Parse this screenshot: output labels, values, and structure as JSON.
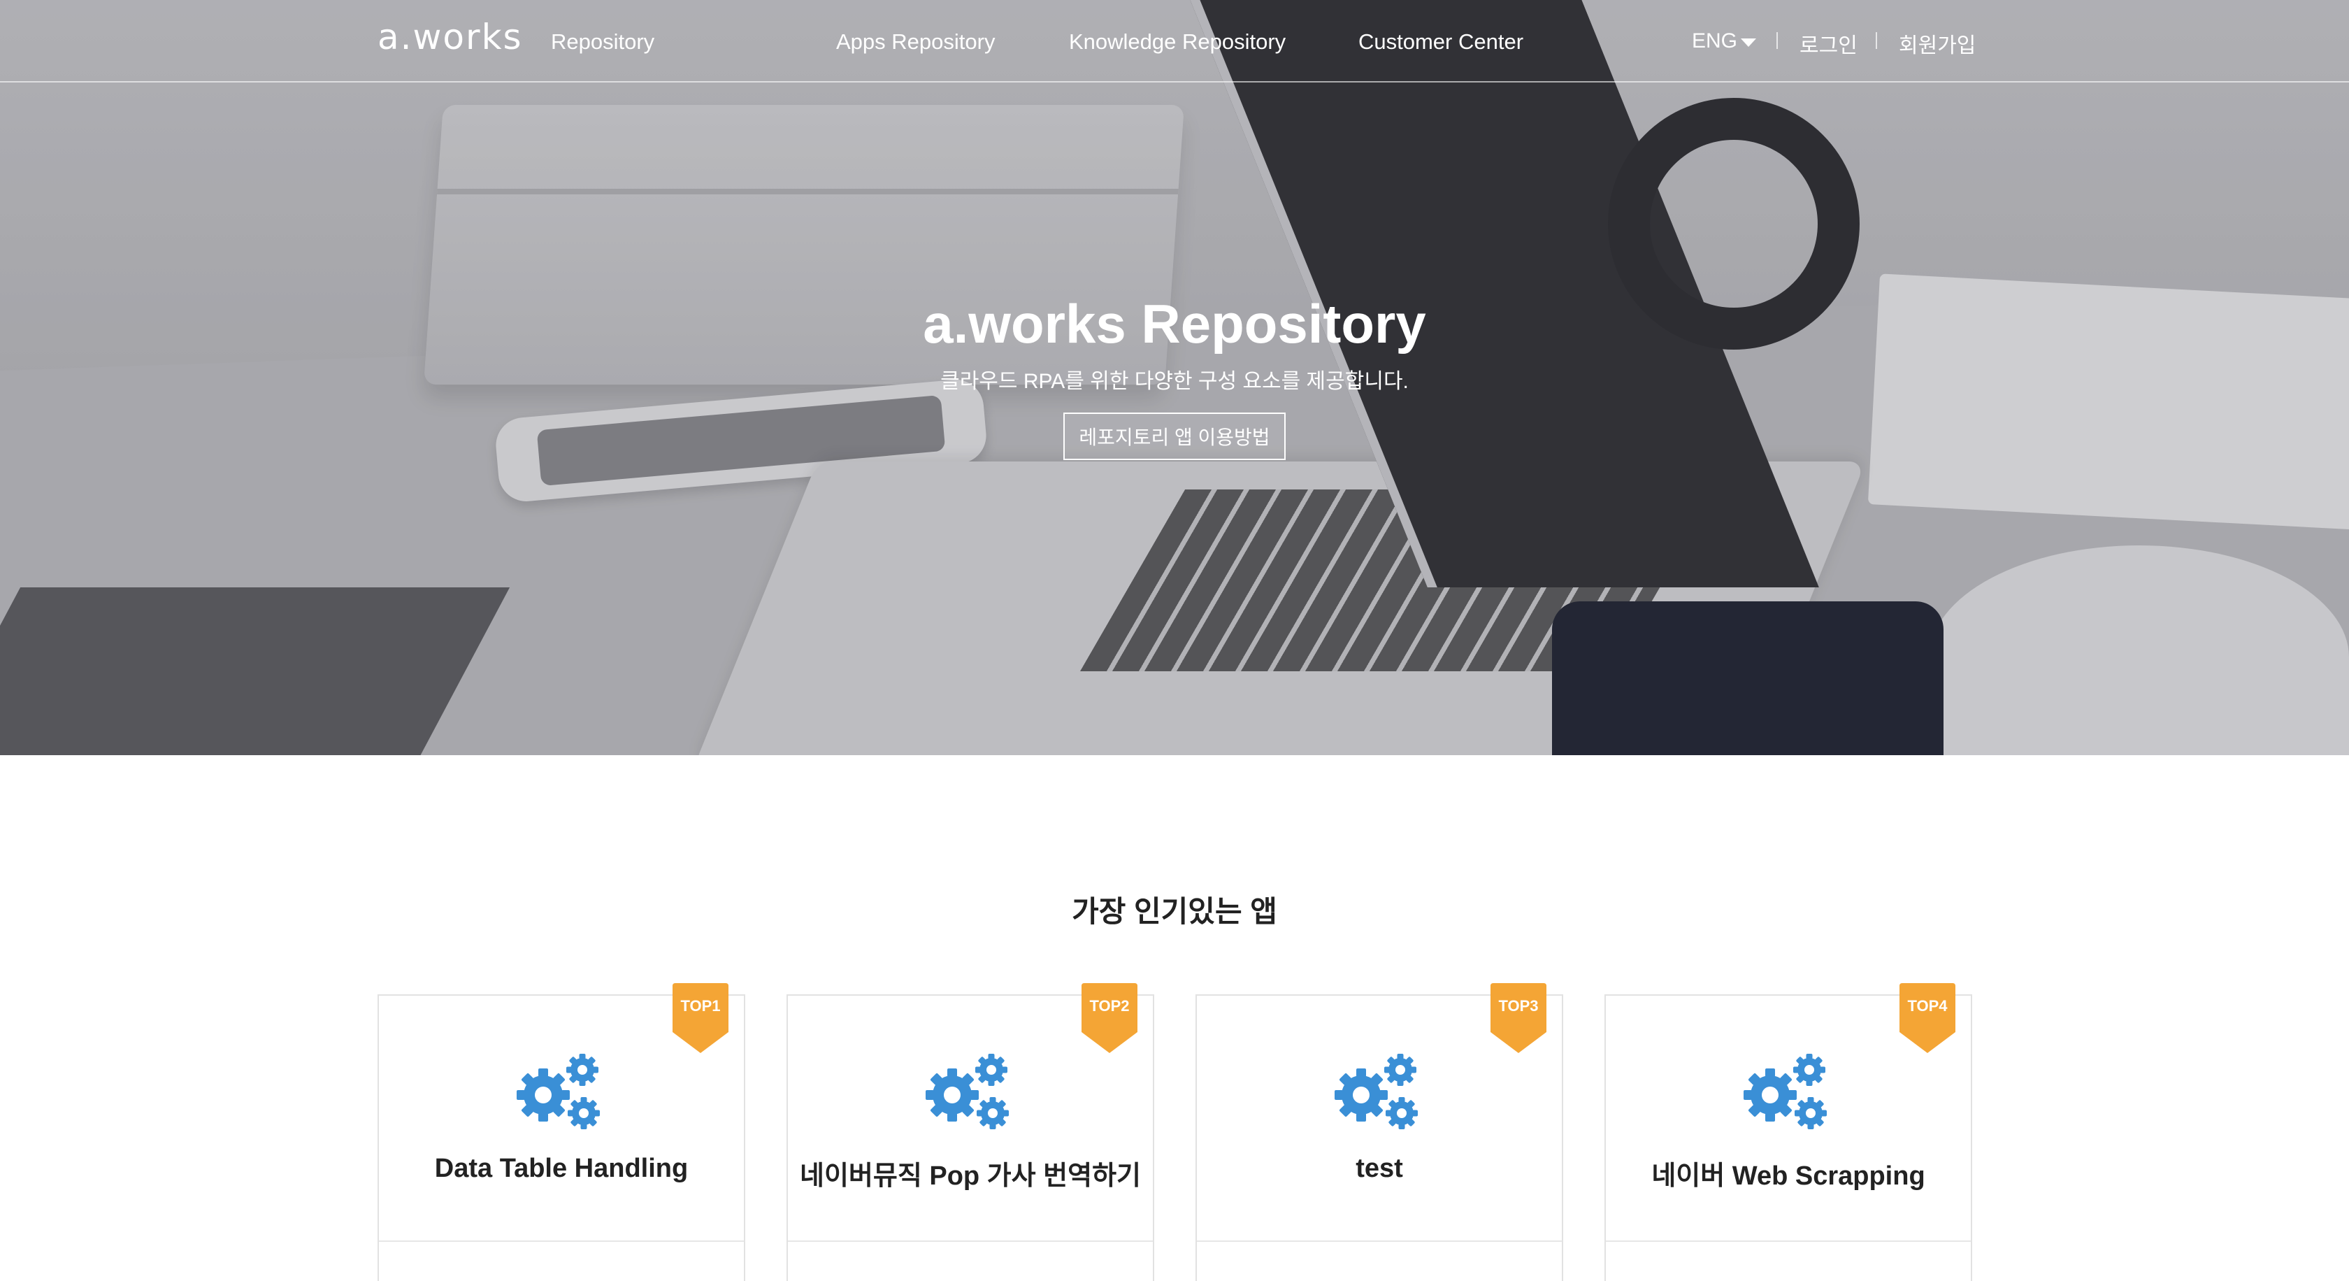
{
  "header": {
    "logo": "a.works",
    "logo_sub": "Repository",
    "nav": [
      "Apps Repository",
      "Knowledge Repository",
      "Customer Center"
    ],
    "language": "ENG",
    "login": "로그인",
    "signup": "회원가입"
  },
  "hero": {
    "title": "a.works Repository",
    "subtitle": "클라우드 RPA를 위한 다양한 구성 요소를 제공합니다.",
    "button": "레포지토리 앱 이용방법"
  },
  "popular": {
    "title": "가장 인기있는 앱",
    "cards": [
      {
        "badge": "TOP1",
        "name": "Data Table Handling",
        "icon": "gears-icon"
      },
      {
        "badge": "TOP2",
        "name": "네이버뮤직 Pop 가사 번역하기",
        "icon": "gears-icon"
      },
      {
        "badge": "TOP3",
        "name": "test",
        "icon": "gears-icon"
      },
      {
        "badge": "TOP4",
        "name": "네이버 Web Scrapping",
        "icon": "gears-icon"
      }
    ]
  },
  "colors": {
    "badge": "#f4a535",
    "gear": "#3a8fd6"
  }
}
